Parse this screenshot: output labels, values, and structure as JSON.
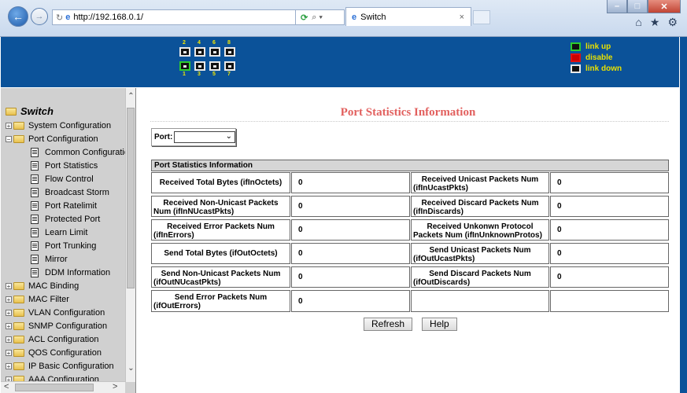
{
  "browser": {
    "url": "http://192.168.0.1/",
    "tab_title": "Switch",
    "tab_close": "×",
    "icons": [
      "back-icon",
      "forward-icon",
      "refresh-icon",
      "ie-icon",
      "search-icon",
      "home-icon",
      "star-icon",
      "gear-icon"
    ]
  },
  "banner": {
    "port_numbers_top": [
      "2",
      "4",
      "6",
      "8"
    ],
    "port_numbers_bottom": [
      "1",
      "3",
      "5",
      "7"
    ],
    "port_status": [
      "up",
      "down",
      "down",
      "down",
      "down",
      "down",
      "down",
      "down"
    ],
    "legend": [
      {
        "label": "link up",
        "color": "#2ecc2e"
      },
      {
        "label": "disable",
        "color": "#e01010"
      },
      {
        "label": "link down",
        "color": "#111111"
      }
    ],
    "text_color": "#e8e000",
    "background": "#0b5299"
  },
  "sidebar": {
    "root": "Switch",
    "items": [
      {
        "label": "System Configuration"
      },
      {
        "label": "Port Configuration"
      },
      {
        "label": "Common Configuratio"
      },
      {
        "label": "Port Statistics"
      },
      {
        "label": "Flow Control"
      },
      {
        "label": "Broadcast Storm"
      },
      {
        "label": "Port Ratelimit"
      },
      {
        "label": "Protected Port"
      },
      {
        "label": "Learn Limit"
      },
      {
        "label": "Port Trunking"
      },
      {
        "label": "Mirror"
      },
      {
        "label": "DDM Information"
      },
      {
        "label": "MAC Binding"
      },
      {
        "label": "MAC Filter"
      },
      {
        "label": "VLAN Configuration"
      },
      {
        "label": "SNMP Configuration"
      },
      {
        "label": "ACL Configuration"
      },
      {
        "label": "QOS Configuration"
      },
      {
        "label": "IP Basic Configuration"
      },
      {
        "label": "AAA Configuration"
      }
    ]
  },
  "main": {
    "title": "Port Statistics Information",
    "title_color": "#e2605e",
    "port_label": "Port:",
    "port_value": "",
    "section_header": "Port Statistics Information",
    "rows": [
      {
        "l_line1": "Received Total Bytes (ifInOctets)",
        "l_line2": "",
        "l_val": "0",
        "r_line1": "Received Unicast Packets Num",
        "r_line2": "(ifInUcastPkts)",
        "r_val": "0"
      },
      {
        "l_line1": "Received Non-Unicast Packets",
        "l_line2": "Num (ifInNUcastPkts)",
        "l_val": "0",
        "r_line1": "Received Discard Packets Num",
        "r_line2": "(ifInDiscards)",
        "r_val": "0"
      },
      {
        "l_line1": "Received Error Packets Num",
        "l_line2": "(ifInErrors)",
        "l_val": "0",
        "r_line1": "Received Unkonwn Protocol",
        "r_line2": "Packets Num (ifInUnknownProtos)",
        "r_val": "0"
      },
      {
        "l_line1": "Send Total Bytes (ifOutOctets)",
        "l_line2": "",
        "l_val": "0",
        "r_line1": "Send Unicast Packets Num",
        "r_line2": "(ifOutUcastPkts)",
        "r_val": "0"
      },
      {
        "l_line1": "Send Non-Unicast Packets Num",
        "l_line2": "(ifOutNUcastPkts)",
        "l_val": "0",
        "r_line1": "Send Discard Packets Num",
        "r_line2": "(ifOutDiscards)",
        "r_val": "0"
      },
      {
        "l_line1": "Send Error Packets Num",
        "l_line2": "(ifOutErrors)",
        "l_val": "0",
        "r_line1": "",
        "r_line2": "",
        "r_val": ""
      }
    ],
    "buttons": {
      "refresh": "Refresh",
      "help": "Help"
    }
  }
}
